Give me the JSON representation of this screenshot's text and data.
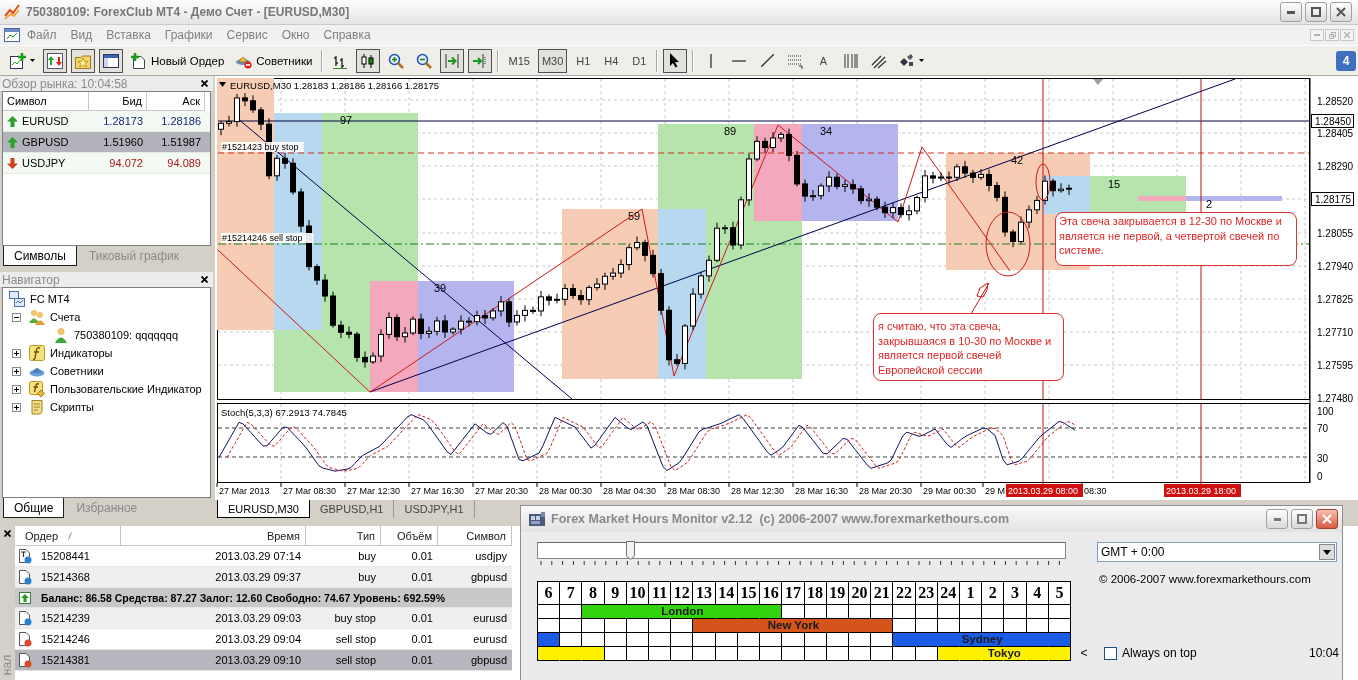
{
  "window": {
    "title": "750380109: ForexClub MT4 - Демо Счет - [EURUSD,M30]"
  },
  "menu": [
    "Файл",
    "Вид",
    "Вставка",
    "Графики",
    "Сервис",
    "Окно",
    "Справка"
  ],
  "toolbar": {
    "groups": [
      [
        {
          "kind": "new-chart",
          "pressed": false
        },
        {
          "kind": "market-watch",
          "pressed": true
        },
        {
          "kind": "navigator",
          "pressed": true
        },
        {
          "kind": "terminal",
          "pressed": true
        },
        {
          "kind": "new-order",
          "label": "Новый Ордер",
          "pressed": false
        },
        {
          "kind": "experts",
          "label": "Советники",
          "pressed": false
        }
      ],
      [
        {
          "kind": "bars",
          "pressed": false
        },
        {
          "kind": "candles",
          "pressed": true
        },
        {
          "kind": "zoom-in",
          "pressed": false
        },
        {
          "kind": "zoom-out",
          "pressed": false
        },
        {
          "kind": "autoscroll",
          "pressed": true
        },
        {
          "kind": "shift",
          "pressed": true
        }
      ],
      [
        {
          "kind": "timeframe",
          "label": "M15",
          "pressed": false
        },
        {
          "kind": "timeframe",
          "label": "M30",
          "pressed": true
        },
        {
          "kind": "timeframe",
          "label": "H1",
          "pressed": false
        },
        {
          "kind": "timeframe",
          "label": "H4",
          "pressed": false
        },
        {
          "kind": "timeframe",
          "label": "D1",
          "pressed": false
        }
      ],
      [
        {
          "kind": "cursor",
          "pressed": true
        }
      ],
      [
        {
          "kind": "vline",
          "pressed": false
        },
        {
          "kind": "hline",
          "pressed": false
        },
        {
          "kind": "trendline",
          "pressed": false
        },
        {
          "kind": "channel",
          "pressed": false
        },
        {
          "kind": "text",
          "label": "A",
          "pressed": false
        },
        {
          "kind": "gann",
          "pressed": false
        },
        {
          "kind": "fibo",
          "pressed": false
        },
        {
          "kind": "shapes",
          "pressed": false
        }
      ]
    ],
    "badge": "4"
  },
  "market_watch": {
    "title": "Обзор рынка: 10:04:58",
    "columns": [
      "Символ",
      "Бид",
      "Аск"
    ],
    "rows": [
      {
        "symbol": "EURUSD",
        "bid": "1.28173",
        "ask": "1.28186",
        "kind": "up",
        "selected": false
      },
      {
        "symbol": "GBPUSD",
        "bid": "1.51960",
        "ask": "1.51987",
        "kind": "up",
        "selected": true
      },
      {
        "symbol": "USDJPY",
        "bid": "94.072",
        "ask": "94.089",
        "kind": "down",
        "selected": false
      }
    ],
    "tabs": [
      {
        "label": "Символы",
        "selected": true
      },
      {
        "label": "Тиковый график",
        "selected": false
      }
    ]
  },
  "navigator": {
    "title": "Навигатор",
    "tree": [
      {
        "label": "FC MT4",
        "kind": "server",
        "children": [
          {
            "label": "Счета",
            "kind": "accounts",
            "expanded": true,
            "children": [
              {
                "label": "750380109: qqqqqqq",
                "kind": "account"
              }
            ]
          },
          {
            "label": "Индикаторы",
            "kind": "indicators",
            "expanded": false
          },
          {
            "label": "Советники",
            "kind": "experts",
            "expanded": false
          },
          {
            "label": "Пользовательские Индикатор",
            "kind": "custom",
            "expanded": false
          },
          {
            "label": "Скрипты",
            "kind": "scripts",
            "expanded": false
          }
        ]
      }
    ],
    "tabs": [
      {
        "label": "Общие",
        "selected": true
      },
      {
        "label": "Избранное",
        "selected": false
      }
    ]
  },
  "chart": {
    "header": "EURUSD,M30 1.28183 1.28186 1.28166 1.28175",
    "price_labels": [
      {
        "text": "1.28520",
        "boxed": false
      },
      {
        "text": "1.28450",
        "boxed": true
      },
      {
        "text": "1.28405",
        "boxed": false
      },
      {
        "text": "1.28290",
        "boxed": false
      },
      {
        "text": "1.28175",
        "boxed": true
      },
      {
        "text": "1.28055",
        "boxed": false
      },
      {
        "text": "1.27940",
        "boxed": false
      },
      {
        "text": "1.27825",
        "boxed": false
      },
      {
        "text": "1.27710",
        "boxed": false
      },
      {
        "text": "1.27595",
        "boxed": false
      },
      {
        "text": "1.27480",
        "boxed": false
      }
    ],
    "box_labels": [
      "97",
      "39",
      "59",
      "89",
      "34",
      "42",
      "15",
      "2"
    ],
    "order_labels": [
      "#1521423 buy stop",
      "#15214246 sell stop"
    ],
    "notes": [
      "Эта свеча закрывается в 12-30 по Москве и является не первой, а четвертой свечей по системе.",
      "я считаю, что эта свеча, закрывшаяся в 10-30 по Москве и является первой свечей Европейской сессии"
    ],
    "indicator": {
      "title": "Stoch(5,3,3) 67.2913 74.7845",
      "levels": [
        "100",
        "70",
        "30",
        "0"
      ]
    },
    "time_labels": [
      "27 Mar 2013",
      "27 Mar 08:30",
      "27 Mar 12:30",
      "27 Mar 16:30",
      "27 Mar 20:30",
      "28 Mar 00:30",
      "28 Mar 04:30",
      "28 Mar 08:30",
      "28 Mar 12:30",
      "28 Mar 16:30",
      "28 Mar 20:30",
      "29 Mar 00:30",
      "29 M",
      "08:30"
    ],
    "line_labels": [
      "2013.03.29 08:00",
      "2013.03.29 18:00"
    ],
    "tabs": [
      {
        "label": "EURUSD,M30",
        "selected": true
      },
      {
        "label": "GBPUSD,H1",
        "selected": false
      },
      {
        "label": "USDJPY,H1",
        "selected": false
      }
    ]
  },
  "terminal": {
    "tab_label": "нал",
    "columns": [
      "Ордер",
      "Время",
      "Тип",
      "Объём",
      "Символ"
    ],
    "rows": [
      {
        "kind": "buy",
        "letter_mark": true,
        "order": "15208441",
        "time": "2013.03.29 07:14",
        "type": "buy",
        "volume": "0.01",
        "symbol": "usdjpy",
        "selected": false
      },
      {
        "kind": "buy",
        "letter_mark": false,
        "order": "15214368",
        "time": "2013.03.29 09:37",
        "type": "buy",
        "volume": "0.01",
        "symbol": "gbpusd",
        "selected": false
      },
      {
        "kind": "balance",
        "text": "Баланс: 86.58 Средства: 87.27 Залог: 12.60 Свободно: 74.67 Уровень: 692.59%",
        "selected": false
      },
      {
        "kind": "buy",
        "letter_mark": false,
        "order": "15214239",
        "time": "2013.03.29 09:03",
        "type": "buy stop",
        "volume": "0.01",
        "symbol": "eurusd",
        "selected": false
      },
      {
        "kind": "sell",
        "letter_mark": false,
        "order": "15214246",
        "time": "2013.03.29 09:04",
        "type": "sell stop",
        "volume": "0.01",
        "symbol": "eurusd",
        "selected": false
      },
      {
        "kind": "sell",
        "letter_mark": false,
        "order": "15214381",
        "time": "2013.03.29 09:10",
        "type": "sell stop",
        "volume": "0.01",
        "symbol": "gbpusd",
        "selected": true
      }
    ]
  },
  "hours_monitor": {
    "title": "Forex Market Hours Monitor v2.12  (c) 2006-2007 www.forexmarkethours.com",
    "slider": {
      "level": 0.17
    },
    "timezone": "GMT + 0:00",
    "copyright": "© 2006-2007 www.forexmarkethours.com",
    "hours": [
      "6",
      "7",
      "8",
      "9",
      "10",
      "11",
      "12",
      "13",
      "14",
      "15",
      "16",
      "17",
      "18",
      "19",
      "20",
      "21",
      "22",
      "23",
      "24",
      "1",
      "2",
      "3",
      "4",
      "5"
    ],
    "sessions": [
      {
        "name": "London",
        "color": "#33d30f",
        "cells": [
          false,
          false,
          true,
          true,
          true,
          true,
          true,
          true,
          true,
          true,
          true,
          false,
          false,
          false,
          false,
          false,
          false,
          false,
          false,
          false,
          false,
          false,
          false,
          false
        ]
      },
      {
        "name": "New York",
        "color": "#d4541c",
        "cells": [
          false,
          false,
          false,
          false,
          false,
          false,
          false,
          true,
          true,
          true,
          true,
          true,
          true,
          true,
          true,
          true,
          false,
          false,
          false,
          false,
          false,
          false,
          false,
          false
        ]
      },
      {
        "name": "Sydney",
        "color": "#1a5ce6",
        "cells": [
          true,
          false,
          false,
          false,
          false,
          false,
          false,
          false,
          false,
          false,
          false,
          false,
          false,
          false,
          false,
          false,
          true,
          true,
          true,
          true,
          true,
          true,
          true,
          true
        ]
      },
      {
        "name": "Tokyo",
        "color": "#fff200",
        "cells": [
          true,
          true,
          true,
          false,
          false,
          false,
          false,
          false,
          false,
          false,
          false,
          false,
          false,
          false,
          false,
          false,
          false,
          false,
          true,
          true,
          true,
          true,
          true,
          true
        ]
      }
    ],
    "scroll_mark": "<",
    "always_on_top": {
      "label": "Always on top",
      "checked": false
    },
    "clock": "10:04"
  }
}
